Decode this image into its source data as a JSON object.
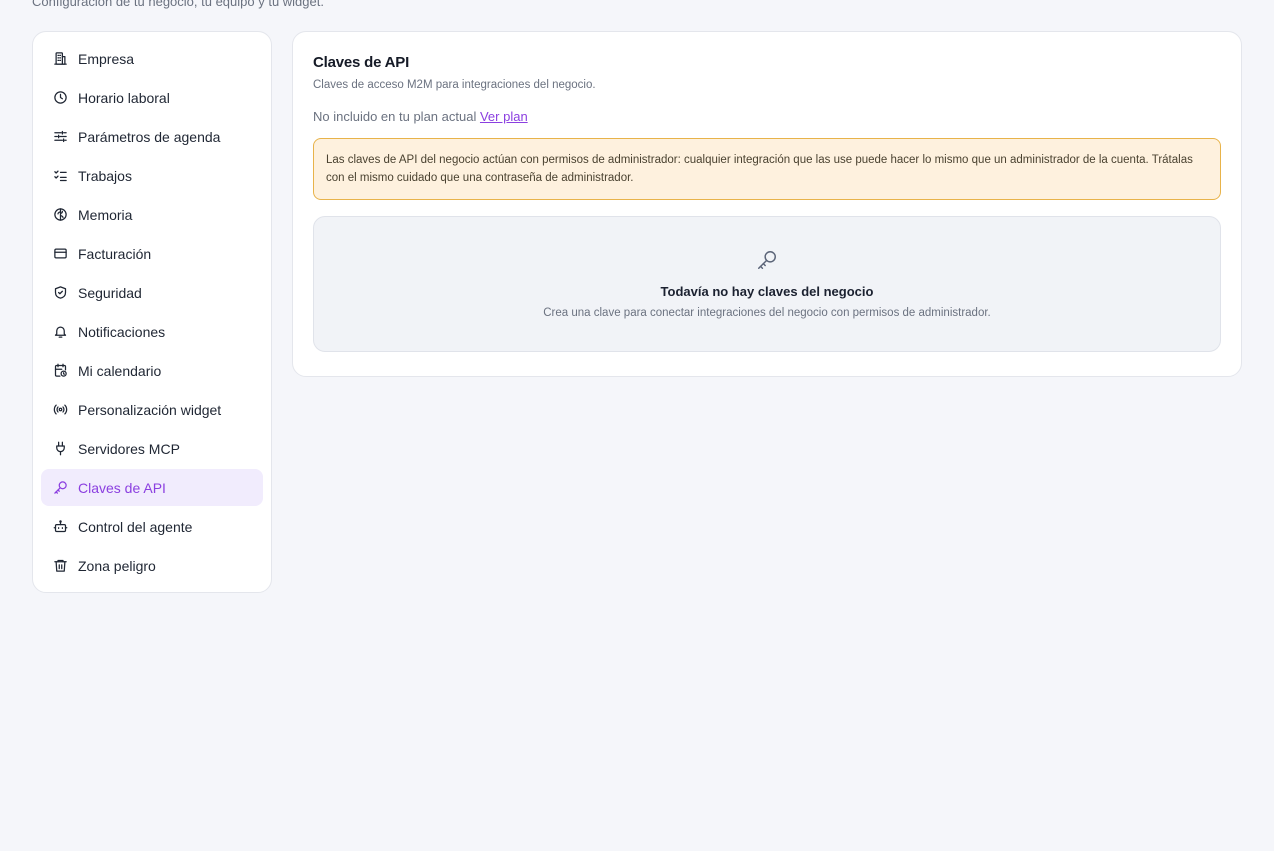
{
  "page": {
    "subtitle": "Configuración de tu negocio, tu equipo y tu widget."
  },
  "sidebar": {
    "items": [
      {
        "label": "Empresa",
        "icon": "building-icon"
      },
      {
        "label": "Horario laboral",
        "icon": "clock-icon"
      },
      {
        "label": "Parámetros de agenda",
        "icon": "sliders-icon"
      },
      {
        "label": "Trabajos",
        "icon": "checklist-icon"
      },
      {
        "label": "Memoria",
        "icon": "brain-icon"
      },
      {
        "label": "Facturación",
        "icon": "credit-card-icon"
      },
      {
        "label": "Seguridad",
        "icon": "shield-check-icon"
      },
      {
        "label": "Notificaciones",
        "icon": "bell-icon"
      },
      {
        "label": "Mi calendario",
        "icon": "calendar-clock-icon"
      },
      {
        "label": "Personalización widget",
        "icon": "radio-icon"
      },
      {
        "label": "Servidores MCP",
        "icon": "plug-icon"
      },
      {
        "label": "Claves de API",
        "icon": "key-icon",
        "active": true
      },
      {
        "label": "Control del agente",
        "icon": "bot-icon"
      },
      {
        "label": "Zona peligro",
        "icon": "trash-icon"
      }
    ]
  },
  "main": {
    "title": "Claves de API",
    "description": "Claves de acceso M2M para integraciones del negocio.",
    "plan_text": "No incluido en tu plan actual",
    "plan_link": "Ver plan",
    "warning": "Las claves de API del negocio actúan con permisos de administrador: cualquier integración que las use puede hacer lo mismo que un administrador de la cuenta. Trátalas con el mismo cuidado que una contraseña de administrador.",
    "empty_title": "Todavía no hay claves del negocio",
    "empty_description": "Crea una clave para conectar integraciones del negocio con permisos de administrador."
  },
  "colors": {
    "accent": "#8b3fe0",
    "active_bg": "#f1ecfd",
    "warning_bg": "#fef1de",
    "warning_border": "#e8b34a"
  }
}
